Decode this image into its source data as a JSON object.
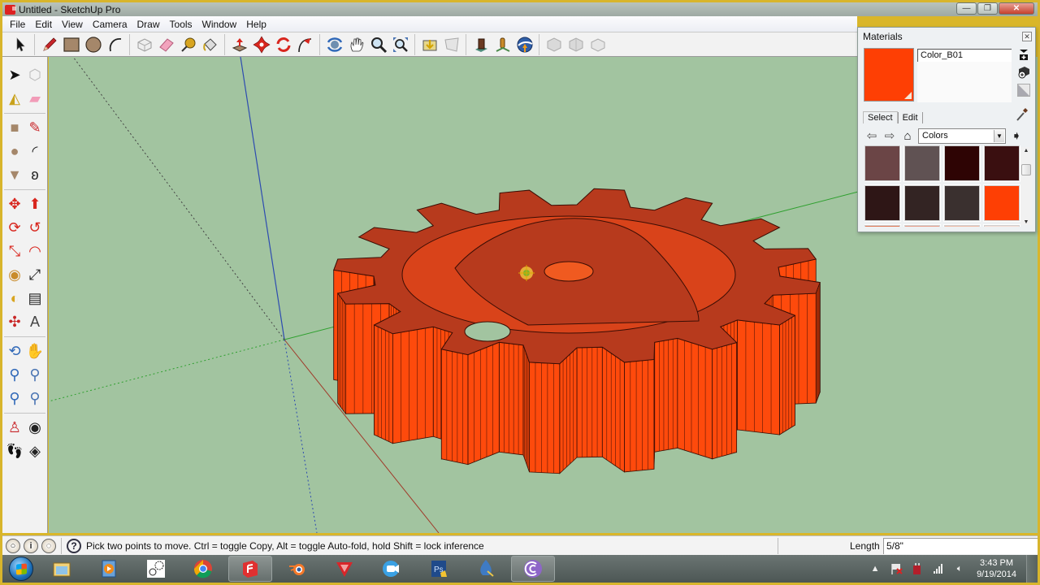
{
  "window": {
    "title": "Untitled - SketchUp Pro",
    "controls": {
      "minimize": "—",
      "restore": "❐",
      "close": "✕"
    }
  },
  "menu": [
    "File",
    "Edit",
    "View",
    "Camera",
    "Draw",
    "Tools",
    "Window",
    "Help"
  ],
  "toolbar_top": [
    {
      "name": "select-tool",
      "icon": "arrow-cursor"
    },
    {
      "name": "pencil-tool",
      "icon": "pencil"
    },
    {
      "name": "rectangle-tool",
      "icon": "rectangle"
    },
    {
      "name": "circle-tool",
      "icon": "circle"
    },
    {
      "name": "arc-tool",
      "icon": "arc"
    },
    {
      "name": "make-component-tool",
      "icon": "component-box"
    },
    {
      "name": "eraser-tool",
      "icon": "eraser"
    },
    {
      "name": "tape-measure-tool",
      "icon": "tape-measure"
    },
    {
      "name": "paint-bucket-tool",
      "icon": "paint-bucket"
    },
    {
      "name": "push-pull-tool",
      "icon": "push-pull"
    },
    {
      "name": "move-tool",
      "icon": "move-arrows"
    },
    {
      "name": "rotate-tool",
      "icon": "rotate"
    },
    {
      "name": "follow-me-tool",
      "icon": "follow-me"
    },
    {
      "name": "orbit-tool",
      "icon": "orbit"
    },
    {
      "name": "pan-tool",
      "icon": "hand"
    },
    {
      "name": "zoom-tool",
      "icon": "magnifier"
    },
    {
      "name": "zoom-extents-tool",
      "icon": "zoom-extents"
    },
    {
      "name": "get-models-tool",
      "icon": "3d-warehouse-download"
    },
    {
      "name": "share-model-tool",
      "icon": "share-model"
    },
    {
      "name": "add-location-tool",
      "icon": "building"
    },
    {
      "name": "toggle-terrain-tool",
      "icon": "location-pin"
    },
    {
      "name": "preview-in-google-earth-tool",
      "icon": "google-earth"
    },
    {
      "name": "get-components-tool",
      "icon": "boxes-grey"
    },
    {
      "name": "share-component-tool",
      "icon": "boxes-grey"
    },
    {
      "name": "extension-warehouse-tool",
      "icon": "box-grey"
    }
  ],
  "toolbar_left": [
    [
      "select",
      "make-component"
    ],
    [
      "paint-bucket",
      "eraser"
    ],
    [
      "rectangle",
      "line"
    ],
    [
      "circle",
      "arc"
    ],
    [
      "polygon",
      "freehand"
    ],
    [
      "move",
      "push-pull"
    ],
    [
      "rotate",
      "follow-me"
    ],
    [
      "scale",
      "offset"
    ],
    [
      "tape-measure",
      "dimension"
    ],
    [
      "protractor",
      "text"
    ],
    [
      "axes",
      "3d-text"
    ],
    [
      "orbit",
      "pan"
    ],
    [
      "zoom",
      "zoom-window"
    ],
    [
      "zoom-extents",
      "previous-view"
    ],
    [
      "position-camera",
      "look-around"
    ],
    [
      "walk",
      "section-plane"
    ]
  ],
  "materials_panel": {
    "title": "Materials",
    "current_material": "Color_B01",
    "current_color": "#fe3f04",
    "tabs": [
      "Select",
      "Edit"
    ],
    "active_tab": "Select",
    "library": "Colors",
    "swatches": [
      "#6b4546",
      "#605253",
      "#2e0404",
      "#3a0f10",
      "#2e1616",
      "#332423",
      "#3a302f",
      "#fe3f04"
    ],
    "partial_row": [
      "#e37a57",
      "#eaa08b",
      "#f0bca7",
      "#f5dcd3"
    ]
  },
  "status_bar": {
    "message": "Pick two points to move.  Ctrl = toggle Copy, Alt = toggle Auto-fold, hold Shift = lock inference",
    "measurement_label": "Length",
    "measurement_value": "5/8\""
  },
  "taskbar": {
    "apps": [
      "Windows Explorer",
      "Media Player",
      "Gear Template",
      "Google Chrome",
      "SketchUp",
      "Blender",
      "Yafaray",
      "Camtasia",
      "Photoshop",
      "Inkscape",
      "Utility"
    ],
    "active": "SketchUp",
    "clock_time": "3:43 PM",
    "clock_date": "9/19/2014",
    "tray": [
      "show-hidden-icons",
      "action-center-flag",
      "power",
      "network-signal",
      "volume"
    ]
  },
  "scene": {
    "model_color": "#fe4a0c",
    "model_top_color": "#b73a1d",
    "background": "#a2c4a0"
  }
}
